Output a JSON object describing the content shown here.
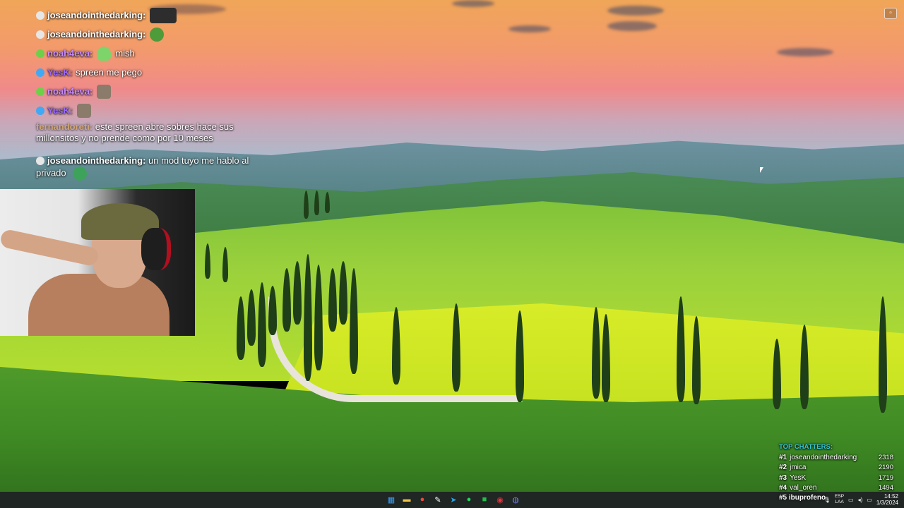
{
  "chat": {
    "messages": [
      {
        "username": "joseandointhedarking:",
        "text": "",
        "name_color": "#ffffff",
        "badge": "ghost-badge",
        "emote": "dark-emote"
      },
      {
        "username": "joseandointhedarking:",
        "text": "",
        "name_color": "#ffffff",
        "badge": "ghost-badge",
        "emote": "pepe-emote"
      },
      {
        "username": "noah4eva:",
        "text": "mish",
        "name_color": "#c78aff",
        "badge": "plant-badge",
        "emote": "slime-emote"
      },
      {
        "username": "YesK:",
        "text": "spreen me pego",
        "name_color": "#9b6bff",
        "badge": "pen-badge",
        "emote": ""
      },
      {
        "username": "noah4eva:",
        "text": "",
        "name_color": "#c78aff",
        "badge": "plant-badge",
        "emote": "cat-emote"
      },
      {
        "username": "YesK:",
        "text": "",
        "name_color": "#9b6bff",
        "badge": "pen-badge",
        "emote": "cat-emote"
      },
      {
        "username": "fernandoreti:",
        "text": "este spreen abre sobres hace sus millonsitos y no prende como por 10 meses",
        "name_color": "#d9a441",
        "badge": "",
        "emote": ""
      },
      {
        "username": "joseandointhedarking:",
        "text": "un mod tuyo me hablo al privado",
        "name_color": "#ffffff",
        "badge": "ghost-badge",
        "emote": "globe-emote"
      }
    ]
  },
  "top_chatters": {
    "title": "TOP CHATTERS:",
    "entries": [
      {
        "rank": "#1",
        "name": "joseandointhedarking",
        "count": "2318"
      },
      {
        "rank": "#2",
        "name": "jmica",
        "count": "2190"
      },
      {
        "rank": "#3",
        "name": "YesK",
        "count": "1719"
      },
      {
        "rank": "#4",
        "name": "val_oren",
        "count": "1494"
      },
      {
        "rank": "#5",
        "name": "ibuprofeno",
        "count": ""
      }
    ]
  },
  "taskbar": {
    "apps": [
      {
        "icon": "windows-start-icon",
        "glyph": "▦",
        "color": "#3aa0ff"
      },
      {
        "icon": "file-explorer-icon",
        "glyph": "▬",
        "color": "#f5c542"
      },
      {
        "icon": "chrome-icon",
        "glyph": "●",
        "color": "#e94b3c"
      },
      {
        "icon": "notepad-icon",
        "glyph": "✎",
        "color": "#ffffff"
      },
      {
        "icon": "telegram-icon",
        "glyph": "➤",
        "color": "#2aa3e0"
      },
      {
        "icon": "spotify-icon",
        "glyph": "●",
        "color": "#1ed760"
      },
      {
        "icon": "green-app-icon",
        "glyph": "■",
        "color": "#1fbf4a"
      },
      {
        "icon": "red-app-icon",
        "glyph": "◉",
        "color": "#e8333c"
      },
      {
        "icon": "discord-icon",
        "glyph": "◍",
        "color": "#6f7cf5"
      }
    ],
    "lang_top": "ESP",
    "lang_bottom": "LAA",
    "time": "14:52",
    "date": "1/3/2024"
  }
}
